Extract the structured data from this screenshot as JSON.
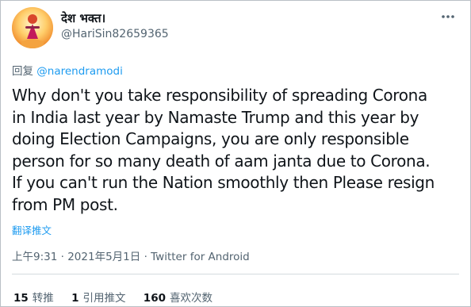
{
  "author": {
    "display_name": "देश भक्त।",
    "handle": "@HariSin82659365"
  },
  "icons": {
    "avatar": "avatar-image",
    "more": "more-options-icon"
  },
  "reply": {
    "prefix": "回复",
    "mention": "@narendramodi"
  },
  "tweet": {
    "text": "Why don't you take responsibility of spreading Corona\nin India last year by Namaste Trump and this year by\ndoing Election Campaigns, you are only responsible\nperson for so many death of aam janta due to Corona.\nIf you can't run the Nation smoothly then Please resign\nfrom PM post.",
    "translate_label": "翻译推文"
  },
  "meta": {
    "time": "上午9:31",
    "separator1": "·",
    "date": "2021年5月1日",
    "separator2": "·",
    "client": "Twitter for Android"
  },
  "stats": {
    "retweets": {
      "count": "15",
      "label": "转推"
    },
    "quotes": {
      "count": "1",
      "label": "引用推文"
    },
    "likes": {
      "count": "160",
      "label": "喜欢次数"
    }
  },
  "colors": {
    "link": "#1d9bf0",
    "secondary_text": "#536471",
    "primary_text": "#0f1419"
  }
}
